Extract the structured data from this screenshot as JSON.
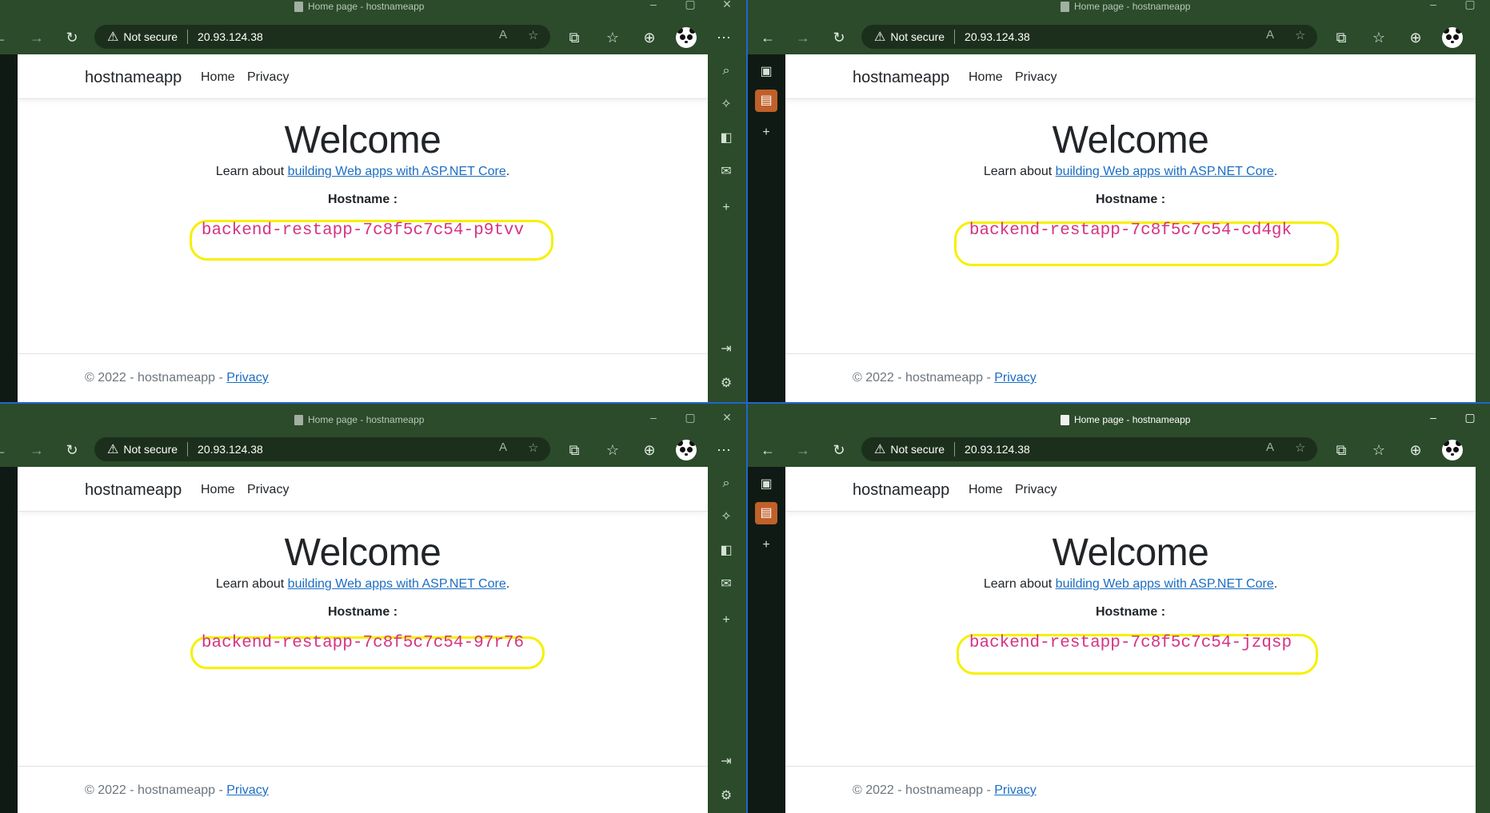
{
  "windows": [
    {
      "tab_title": "Home page - hostnameapp",
      "address_security": "Not secure",
      "address_url": "20.93.124.38",
      "page": {
        "brand": "hostnameapp",
        "nav_home": "Home",
        "nav_privacy": "Privacy",
        "welcome": "Welcome",
        "learn_prefix": "Learn about ",
        "learn_link": "building Web apps with ASP.NET Core",
        "learn_suffix": ".",
        "hostname_label": "Hostname :",
        "hostname_value": "backend-restapp-7c8f5c7c54-p9tvv",
        "footer_text": "© 2022 - hostnameapp - ",
        "footer_link": "Privacy"
      }
    },
    {
      "tab_title": "Home page - hostnameapp",
      "address_security": "Not secure",
      "address_url": "20.93.124.38",
      "page": {
        "brand": "hostnameapp",
        "nav_home": "Home",
        "nav_privacy": "Privacy",
        "welcome": "Welcome",
        "learn_prefix": "Learn about ",
        "learn_link": "building Web apps with ASP.NET Core",
        "learn_suffix": ".",
        "hostname_label": "Hostname :",
        "hostname_value": "backend-restapp-7c8f5c7c54-cd4gk",
        "footer_text": "© 2022 - hostnameapp - ",
        "footer_link": "Privacy"
      }
    },
    {
      "tab_title": "Home page - hostnameapp",
      "address_security": "Not secure",
      "address_url": "20.93.124.38",
      "page": {
        "brand": "hostnameapp",
        "nav_home": "Home",
        "nav_privacy": "Privacy",
        "welcome": "Welcome",
        "learn_prefix": "Learn about ",
        "learn_link": "building Web apps with ASP.NET Core",
        "learn_suffix": ".",
        "hostname_label": "Hostname :",
        "hostname_value": "backend-restapp-7c8f5c7c54-97r76",
        "footer_text": "© 2022 - hostnameapp - ",
        "footer_link": "Privacy"
      }
    },
    {
      "tab_title": "Home page - hostnameapp",
      "address_security": "Not secure",
      "address_url": "20.93.124.38",
      "page": {
        "brand": "hostnameapp",
        "nav_home": "Home",
        "nav_privacy": "Privacy",
        "welcome": "Welcome",
        "learn_prefix": "Learn about ",
        "learn_link": "building Web apps with ASP.NET Core",
        "learn_suffix": ".",
        "hostname_label": "Hostname :",
        "hostname_value": "backend-restapp-7c8f5c7c54-jzqsp",
        "footer_text": "© 2022 - hostnameapp - ",
        "footer_link": "Privacy"
      }
    }
  ],
  "icons": {
    "back": "back-arrow-icon",
    "forward": "forward-arrow-icon",
    "refresh": "refresh-icon",
    "warning": "warning-icon",
    "read_aloud": "read-aloud-icon",
    "add_favorite": "add-favorite-icon",
    "extensions": "extensions-icon",
    "favorites": "favorites-icon",
    "collections": "collections-icon",
    "profile": "profile-avatar-icon",
    "more": "more-icon"
  },
  "colors": {
    "frame": "#2b4b2b",
    "highlight": "#f6f000",
    "hostname": "#d63384",
    "link": "#1b6ec2"
  }
}
